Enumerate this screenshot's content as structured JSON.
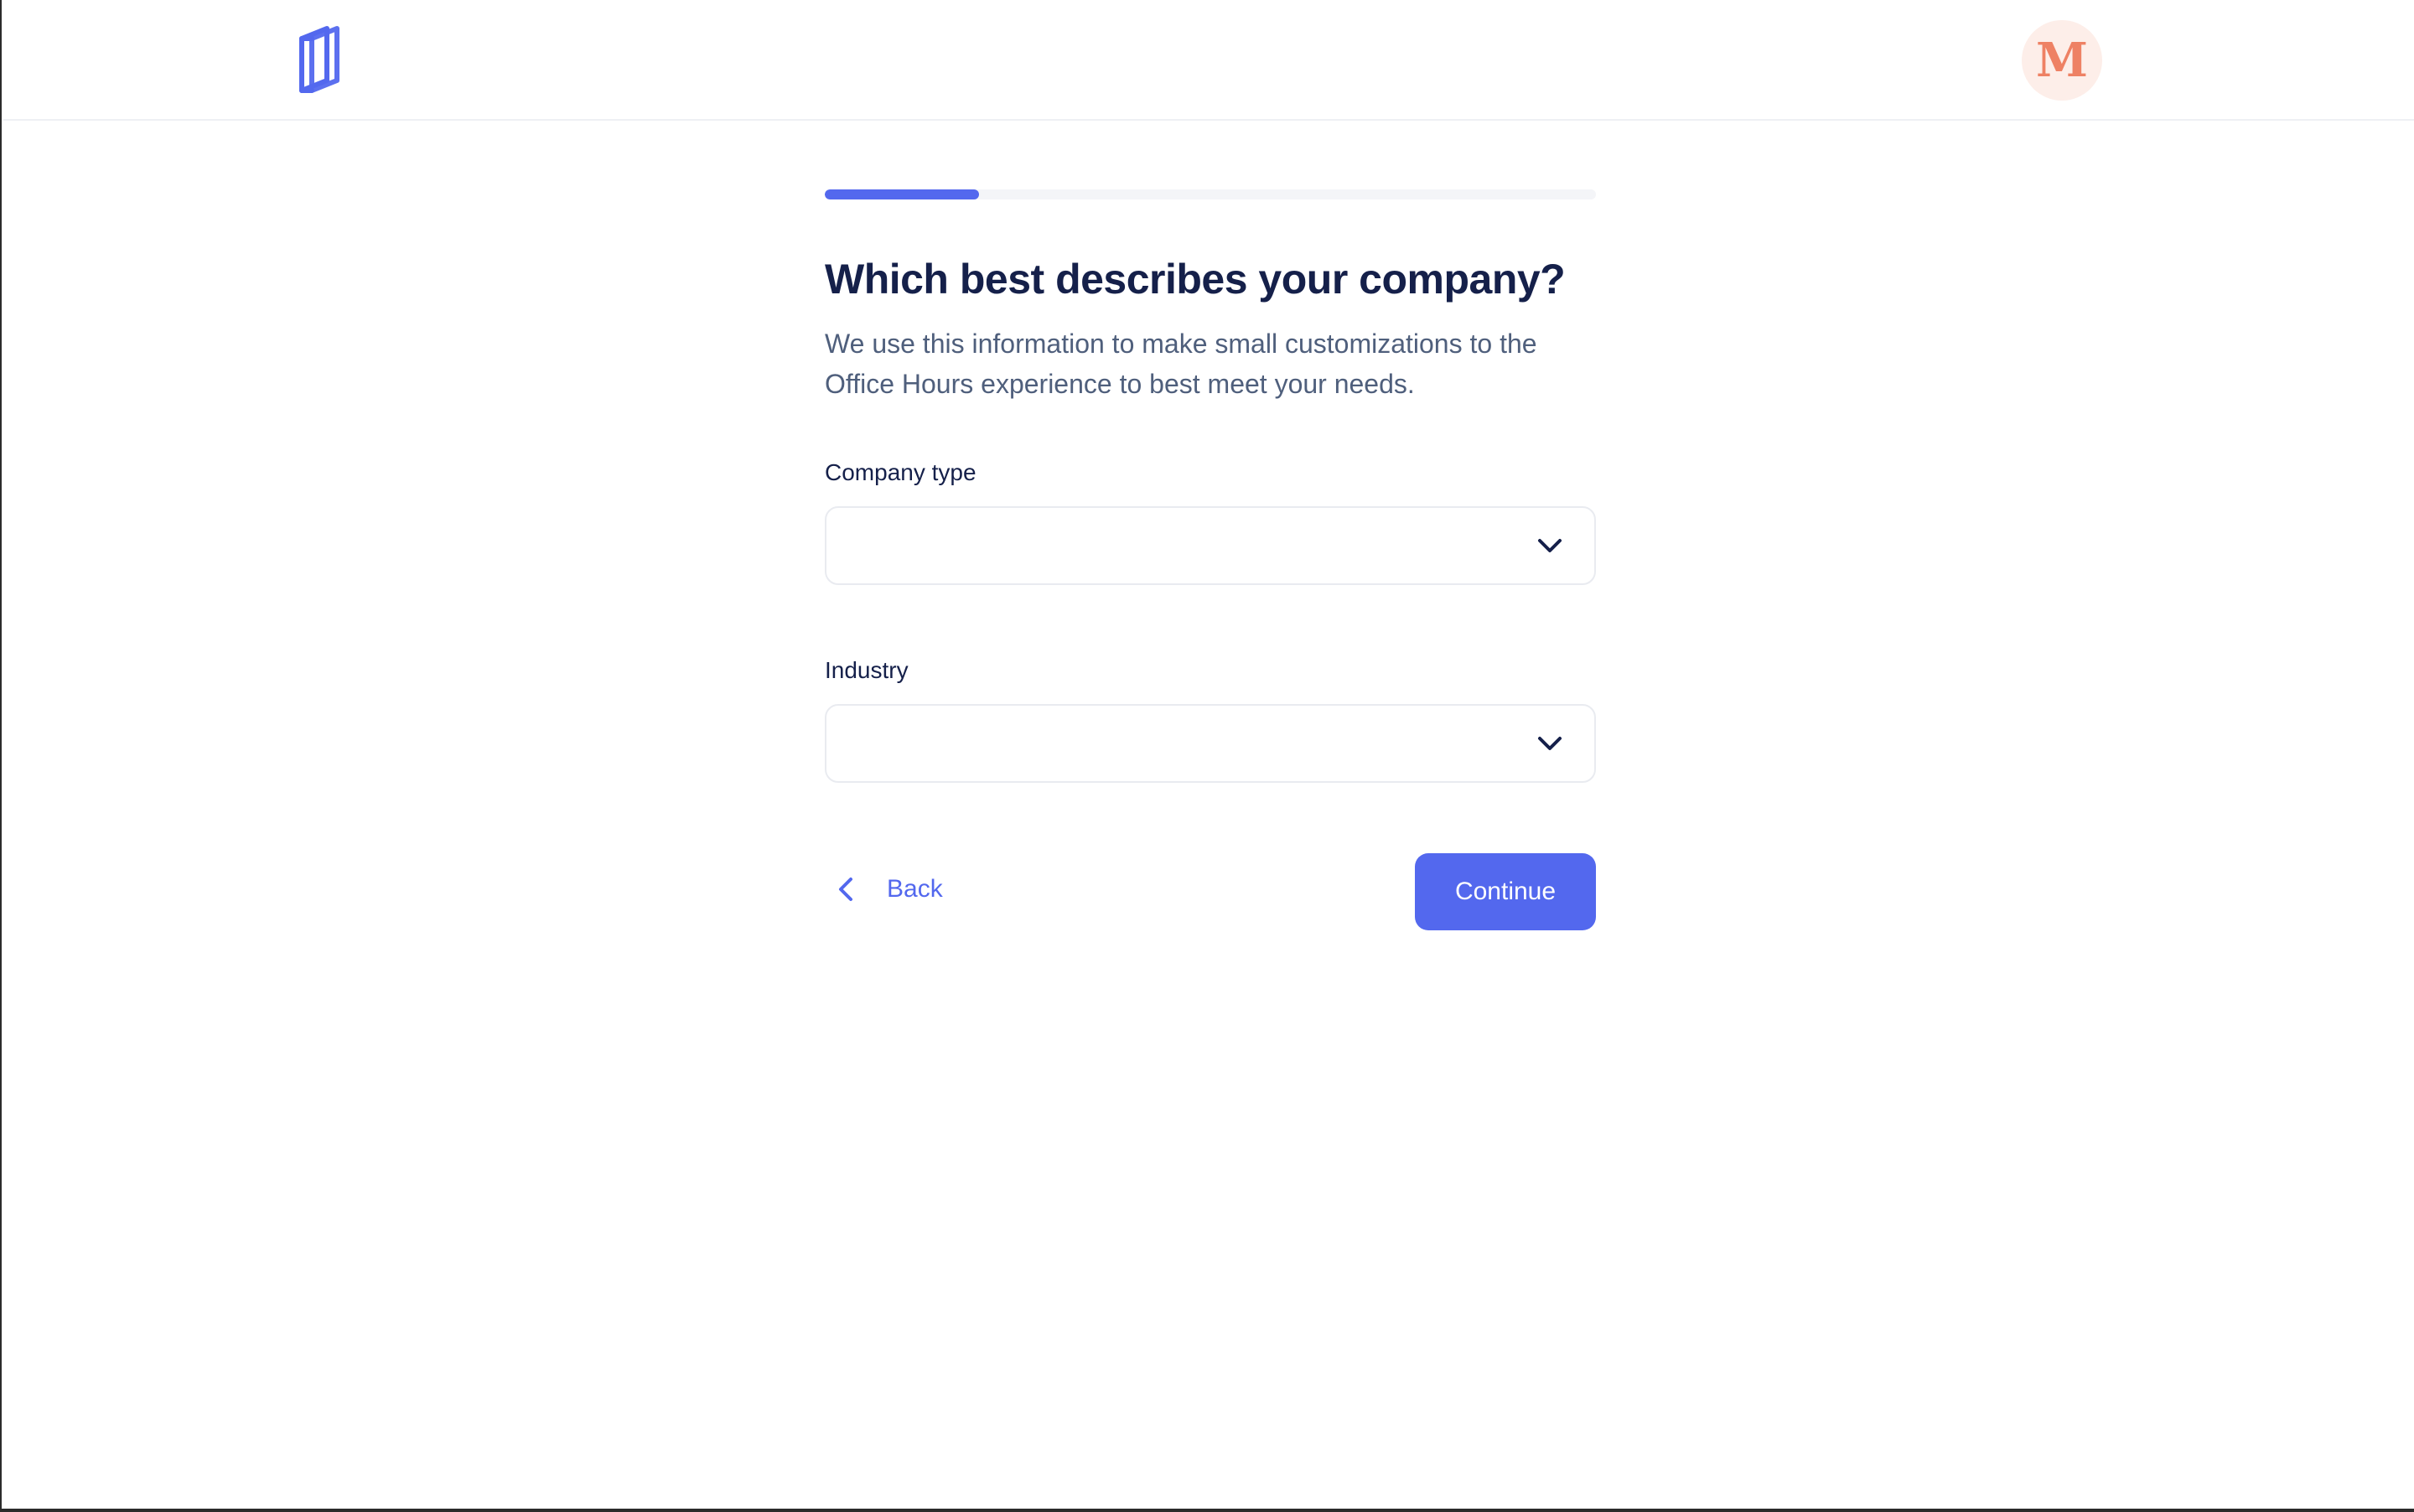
{
  "header": {
    "logo_icon": "book-logo-icon",
    "avatar_initial": "M",
    "avatar_color": "#ee8164",
    "avatar_bg": "#fdeee9"
  },
  "progress": {
    "fraction": 0.2,
    "color": "#5368ee"
  },
  "main": {
    "title": "Which best describes your company?",
    "subtitle": "We use this information to make small customizations to the Office Hours experience to best meet your needs."
  },
  "form": {
    "company_type": {
      "label": "Company type",
      "value": "",
      "icon": "chevron-down-icon"
    },
    "industry": {
      "label": "Industry",
      "value": "",
      "icon": "chevron-down-icon"
    }
  },
  "actions": {
    "back_label": "Back",
    "back_icon": "chevron-left-icon",
    "continue_label": "Continue",
    "accent": "#5368ee"
  }
}
